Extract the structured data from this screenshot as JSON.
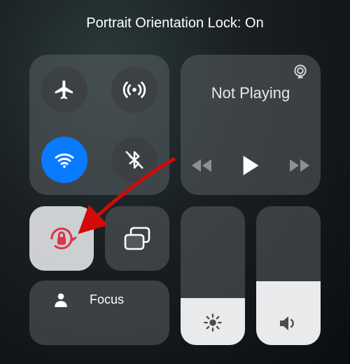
{
  "status": {
    "text": "Portrait Orientation Lock: On"
  },
  "connectivity": {
    "airplane": {
      "on": false
    },
    "cellular": {
      "on": false
    },
    "wifi": {
      "on": true
    },
    "bluetooth": {
      "on": false
    }
  },
  "media": {
    "now_playing": "Not Playing"
  },
  "orientation_lock": {
    "on": true
  },
  "focus": {
    "label": "Focus"
  },
  "brightness": {
    "level_pct": 34
  },
  "volume": {
    "level_pct": 46
  },
  "colors": {
    "accent_blue": "#0a7aff",
    "lock_red": "#d9364a"
  }
}
